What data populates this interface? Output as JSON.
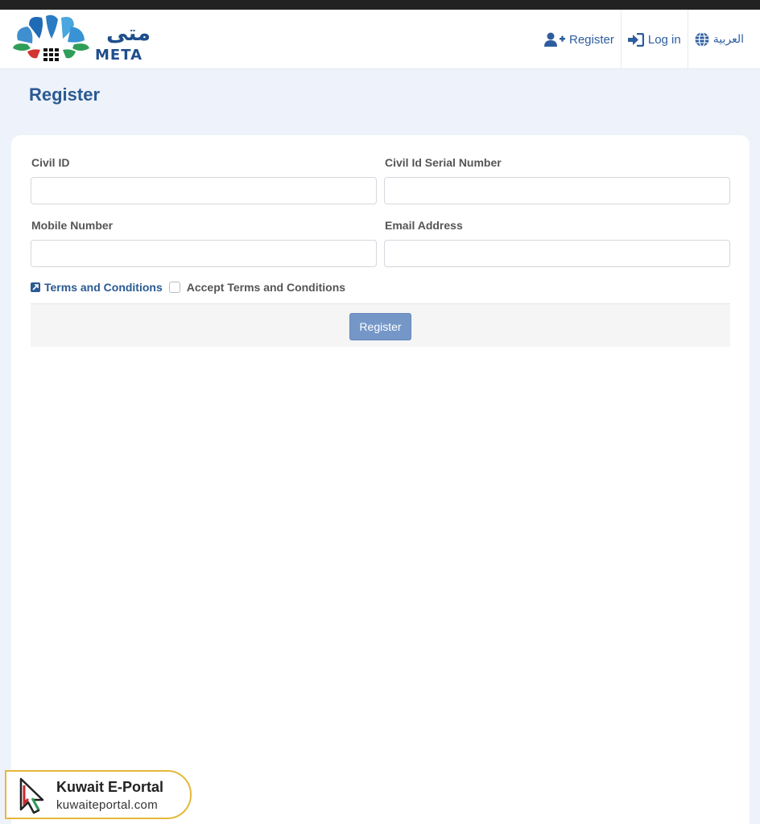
{
  "brand": {
    "logo_arabic": "متى",
    "logo_english": "META"
  },
  "nav": {
    "register_label": "Register",
    "login_label": "Log in",
    "language_label": "العربية"
  },
  "page": {
    "title": "Register"
  },
  "form": {
    "civil_id": {
      "label": "Civil ID",
      "value": "",
      "placeholder": ""
    },
    "serial_number": {
      "label": "Civil Id Serial Number",
      "value": "",
      "placeholder": ""
    },
    "mobile": {
      "label": "Mobile Number",
      "value": "",
      "placeholder": ""
    },
    "email": {
      "label": "Email Address",
      "value": "",
      "placeholder": ""
    },
    "terms_link": "Terms and Conditions",
    "accept_terms": "Accept Terms and Conditions",
    "accept_checked": false,
    "submit_label": "Register"
  },
  "watermark": {
    "title": "Kuwait E-Portal",
    "url": "kuwaiteportal.com"
  },
  "colors": {
    "primary": "#2a5a93",
    "button": "#7497c8",
    "page_bg": "#eef2fa"
  },
  "icons": {
    "register": "user-plus-icon",
    "login": "sign-in-icon",
    "language": "globe-icon",
    "terms": "external-link-icon"
  }
}
